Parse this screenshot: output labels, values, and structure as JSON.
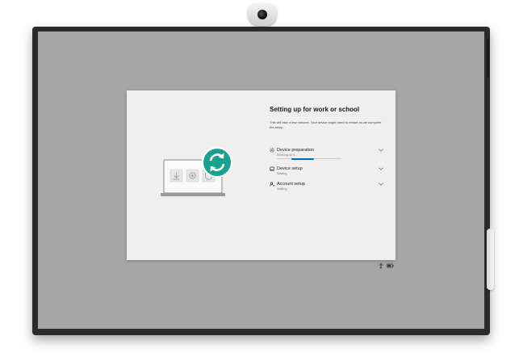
{
  "setup": {
    "title": "Setting up for work or school",
    "subtitle": "This will take a few minutes. Your device might need to restart as we complete the setup.",
    "steps": [
      {
        "label": "Device preparation",
        "status": "Working on it...",
        "icon": "gear-icon",
        "progress": 0.35
      },
      {
        "label": "Device setup",
        "status": "Waiting",
        "icon": "device-icon"
      },
      {
        "label": "Account setup",
        "status": "Waiting",
        "icon": "account-icon"
      }
    ]
  },
  "colors": {
    "accent": "#0067c0",
    "sync_badge": "#1aa08e",
    "screen": "#a6a6a6",
    "dialog": "#efefef"
  },
  "taskbar_icons": [
    "accessibility-icon",
    "battery-icon"
  ]
}
